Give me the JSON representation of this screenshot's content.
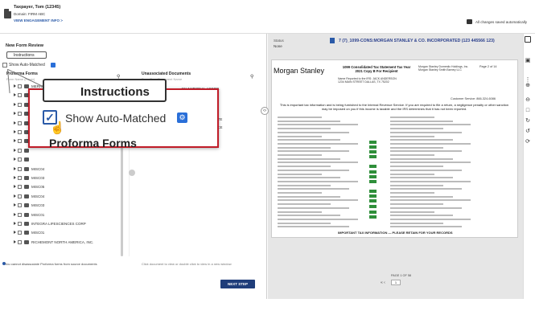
{
  "header": {
    "client_name": "Taxpayer, Tom (12345)",
    "domain_line": "Domain: FIRM ABC",
    "engagement_link": "VIEW ENGAGEMENT INFO >",
    "save_status": "All changes saved automatically"
  },
  "left": {
    "panel_title": "New Form Review",
    "instructions_label": "Instructions",
    "show_auto_matched_label": "Show Auto-Matched",
    "proforma_heading": "Proforma Forms",
    "proforma_sub": "Form Name (Payer)",
    "unassociated_heading": "Unassociated Documents",
    "unassociated_sub": "Form Type Document Name",
    "proforma_items": [
      "MERRILL LYNCH (###-5###5)",
      "",
      "",
      "",
      "",
      "",
      "",
      "",
      "",
      "MISC04",
      "MISC03",
      "MISC05",
      "MISC04",
      "MISC03",
      "MISC01",
      "INTEGRA LIFESCIENCES CORP",
      "MISC01",
      "RICHEMONT NORTH AMERICA, INC."
    ],
    "unassociated_items": [
      "NK NATIONAL ASSOC.",
      "L INC",
      "ORPORATION",
      "ORPORATION",
      "Y & CO. INCORPORATE",
      "INTEGRA LIFESCIENCE"
    ],
    "left_footnote": "You cannot disassociate Proforma forms from source documents",
    "right_footnote": "Click document to view or double click to view in a new window",
    "next_step_label": "NEXT STEP"
  },
  "document": {
    "status_label": "Status",
    "status_value": "None",
    "title": "7 (7)_1099-CONS:MORGAN STANLEY & CO. INCORPORATED (123 445566 123)",
    "logo_text": "Morgan Stanley",
    "tax_title": "1099 Consolidated Tax Statement Tax Year 2021 Copy B For Recipient",
    "payer_block": "Morgan Stanley Domestic Holdings, Inc. Morgan Stanley Smith Barney LLC",
    "page_num": "Page 2 of 14",
    "recipient": "Name Reported to the IRS: JACK ANDERSON 1234 MAIN STREET DALLAS, TX 75202",
    "customer_service": "Customer Service: 866-324-6086",
    "notice": "This is important tax information and is being furnished to the Internal Revenue Service. If you are required to file a return, a negligence penalty or other sanction may be imposed on you if this income is taxable and the IRS determines that it has not been reported.",
    "footer": "IMPORTANT TAX INFORMATION — PLEASE RETAIN FOR YOUR RECORDS",
    "pager_label": "PAGE 1 OF 58",
    "pager_value": "1"
  },
  "zoom": {
    "instructions_label": "Instructions",
    "show_auto_matched_label": "Show Auto-Matched",
    "proforma_heading": "Proforma Forms",
    "checkmark": "✓"
  },
  "colors": {
    "accent": "#2a5aa8",
    "callout_border": "#c01c28",
    "next_step_bg": "#1f3d7a",
    "match_green": "#2f8f3a"
  }
}
